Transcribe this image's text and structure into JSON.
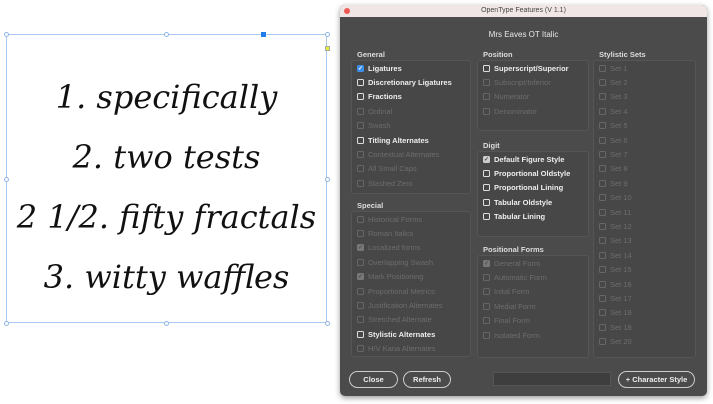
{
  "document": {
    "lines": [
      "1. specifically",
      "2. two tests",
      "2 1/2. fifty fractals",
      "3. witty waffles"
    ]
  },
  "dialog": {
    "title": "OpenType Features (V 1.1)",
    "font_name": "Mrs Eaves OT Italic",
    "accent_color": "#3d8ee8",
    "groups": {
      "general": {
        "label": "General",
        "items": [
          {
            "label": "Ligatures",
            "checked": true,
            "enabled": true
          },
          {
            "label": "Discretionary Ligatures",
            "checked": false,
            "enabled": true
          },
          {
            "label": "Fractions",
            "checked": false,
            "enabled": true
          },
          {
            "label": "Ordinal",
            "checked": false,
            "enabled": false
          },
          {
            "label": "Swash",
            "checked": false,
            "enabled": false
          },
          {
            "label": "Titling Alternates",
            "checked": false,
            "enabled": true
          },
          {
            "label": "Contextual Alternates",
            "checked": false,
            "enabled": false
          },
          {
            "label": "All Small Caps",
            "checked": false,
            "enabled": false
          },
          {
            "label": "Slashed Zero",
            "checked": false,
            "enabled": false
          }
        ]
      },
      "special": {
        "label": "Special",
        "items": [
          {
            "label": "Historical Forms",
            "checked": false,
            "enabled": false
          },
          {
            "label": "Roman Italics",
            "checked": false,
            "enabled": false
          },
          {
            "label": "Localized forms",
            "checked": true,
            "enabled": false
          },
          {
            "label": "Overlapping Swash",
            "checked": false,
            "enabled": false
          },
          {
            "label": "Mark Positioning",
            "checked": true,
            "enabled": false
          },
          {
            "label": "Proportional Metrics",
            "checked": false,
            "enabled": false
          },
          {
            "label": "Justification Alternates",
            "checked": false,
            "enabled": false
          },
          {
            "label": "Stretched Alternate",
            "checked": false,
            "enabled": false
          },
          {
            "label": "Stylistic Alternates",
            "checked": false,
            "enabled": true
          },
          {
            "label": "H/V Kana Alternates",
            "checked": false,
            "enabled": false
          }
        ]
      },
      "position": {
        "label": "Position",
        "items": [
          {
            "label": "Superscript/Superior",
            "checked": false,
            "enabled": true
          },
          {
            "label": "Subscript/Inferior",
            "checked": false,
            "enabled": false
          },
          {
            "label": "Numerator",
            "checked": false,
            "enabled": false
          },
          {
            "label": "Denominator",
            "checked": false,
            "enabled": false
          }
        ]
      },
      "digit": {
        "label": "Digit",
        "items": [
          {
            "label": "Default Figure Style",
            "checked": true,
            "enabled": true
          },
          {
            "label": "Proportional Oldstyle",
            "checked": false,
            "enabled": true
          },
          {
            "label": "Proportional Lining",
            "checked": false,
            "enabled": true
          },
          {
            "label": "Tabular Oldstyle",
            "checked": false,
            "enabled": true
          },
          {
            "label": "Tabular Lining",
            "checked": false,
            "enabled": true
          }
        ]
      },
      "positional_forms": {
        "label": "Positional Forms",
        "items": [
          {
            "label": "General Form",
            "checked": true,
            "enabled": false
          },
          {
            "label": "Automatic Form",
            "checked": false,
            "enabled": false
          },
          {
            "label": "Inital Form",
            "checked": false,
            "enabled": false
          },
          {
            "label": "Medial Form",
            "checked": false,
            "enabled": false
          },
          {
            "label": "Final Form",
            "checked": false,
            "enabled": false
          },
          {
            "label": "Isolated Form",
            "checked": false,
            "enabled": false
          }
        ]
      },
      "stylistic_sets": {
        "label": "Stylistic Sets",
        "items": [
          {
            "label": "Set 1",
            "checked": false,
            "enabled": false
          },
          {
            "label": "Set 2",
            "checked": false,
            "enabled": false
          },
          {
            "label": "Set 3",
            "checked": false,
            "enabled": false
          },
          {
            "label": "Set 4",
            "checked": false,
            "enabled": false
          },
          {
            "label": "Set 5",
            "checked": false,
            "enabled": false
          },
          {
            "label": "Set 6",
            "checked": false,
            "enabled": false
          },
          {
            "label": "Set 7",
            "checked": false,
            "enabled": false
          },
          {
            "label": "Set 8",
            "checked": false,
            "enabled": false
          },
          {
            "label": "Set 9",
            "checked": false,
            "enabled": false
          },
          {
            "label": "Set 10",
            "checked": false,
            "enabled": false
          },
          {
            "label": "Set 11",
            "checked": false,
            "enabled": false
          },
          {
            "label": "Set 12",
            "checked": false,
            "enabled": false
          },
          {
            "label": "Set 13",
            "checked": false,
            "enabled": false
          },
          {
            "label": "Set 14",
            "checked": false,
            "enabled": false
          },
          {
            "label": "Set 15",
            "checked": false,
            "enabled": false
          },
          {
            "label": "Set 16",
            "checked": false,
            "enabled": false
          },
          {
            "label": "Set 17",
            "checked": false,
            "enabled": false
          },
          {
            "label": "Set 18",
            "checked": false,
            "enabled": false
          },
          {
            "label": "Set 18",
            "checked": false,
            "enabled": false
          },
          {
            "label": "Set 20",
            "checked": false,
            "enabled": false
          }
        ]
      }
    },
    "buttons": {
      "close": "Close",
      "refresh": "Refresh",
      "character_style": "+ Character Style"
    },
    "style_name_input": {
      "value": ""
    }
  }
}
